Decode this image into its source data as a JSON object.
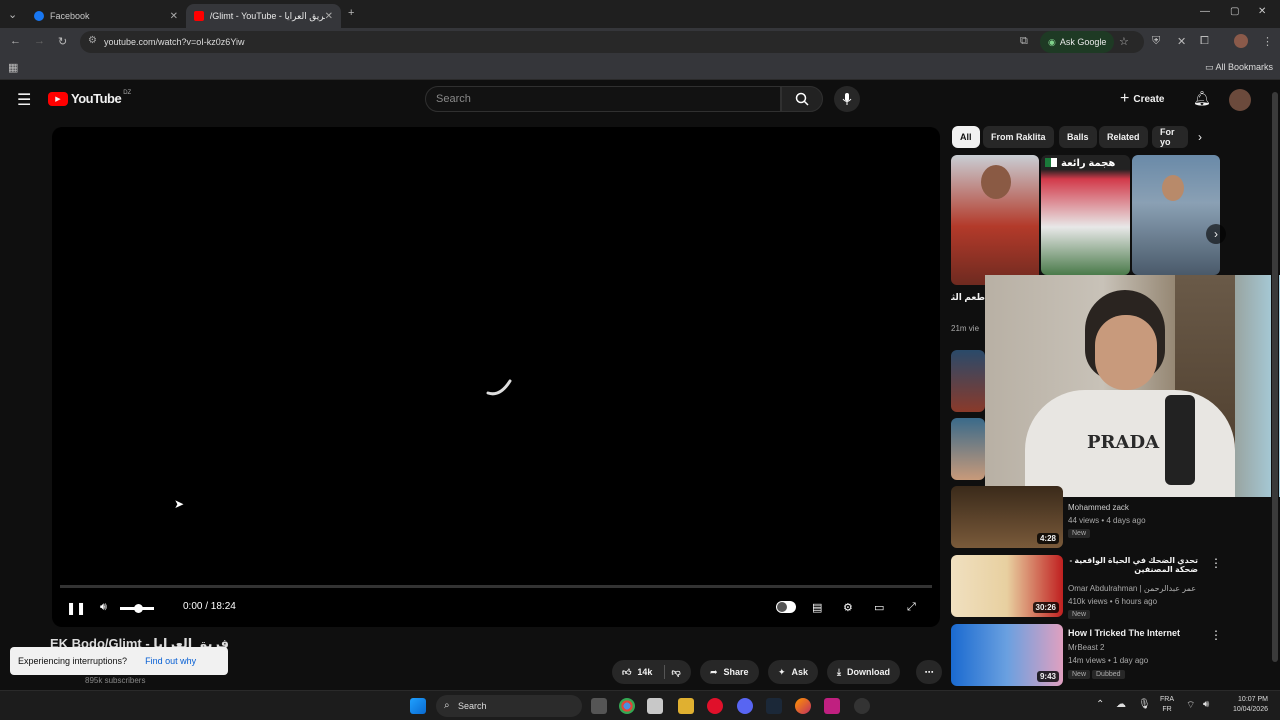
{
  "browser": {
    "tabs": [
      {
        "label": "Facebook",
        "color": "#1877f2"
      },
      {
        "label": "/Glimt - YouTube - فريق العرايا",
        "color": "#ff0000"
      }
    ],
    "url": "youtube.com/watch?v=oI-kz0z6Yiw",
    "ask_google": "Ask Google",
    "all_bookmarks": "All Bookmarks"
  },
  "youtube": {
    "logo_text": "YouTube",
    "region": "DZ",
    "search_placeholder": "Search",
    "create_label": "Create"
  },
  "player": {
    "time": "0:00 / 18:24",
    "video_title": "EK Bodo/Glimt - فريق العرايا",
    "subscribers": "895k subscribers",
    "actions": {
      "likes": "14k",
      "share": "Share",
      "ask": "Ask",
      "download": "Download"
    }
  },
  "toast": {
    "message": "Experiencing interruptions?",
    "link": "Find out why"
  },
  "sidebar": {
    "chips": [
      "All",
      "From Raklita",
      "Balls",
      "Related",
      "For yo"
    ],
    "shorts_caption": "هجمة رائعة",
    "partial_title_1": "طعم الثلج الحقيقي؟",
    "partial_meta_1": "21m vie",
    "videos": [
      {
        "title": "",
        "channel": "Mohammed zack",
        "meta": "44 views • 4 days ago",
        "badge": "New",
        "duration": "4:28"
      },
      {
        "title": "تحدي الضحك في الحياة الواقعية - ضحكة المصنفين",
        "channel": "Omar Abdulrahman | عمر عبدالرحمن",
        "meta": "410k views • 6 hours ago",
        "badge": "New",
        "duration": "30:26"
      },
      {
        "title": "How I Tricked The Internet",
        "channel": "MrBeast 2",
        "meta": "14m views • 1 day ago",
        "badge": "New",
        "badge2": "Dubbed",
        "duration": "9:43"
      }
    ]
  },
  "taskbar": {
    "search": "Search",
    "lang": "FRA",
    "lang2": "FR",
    "time": "10:07 PM",
    "date": "10/04/2026"
  }
}
